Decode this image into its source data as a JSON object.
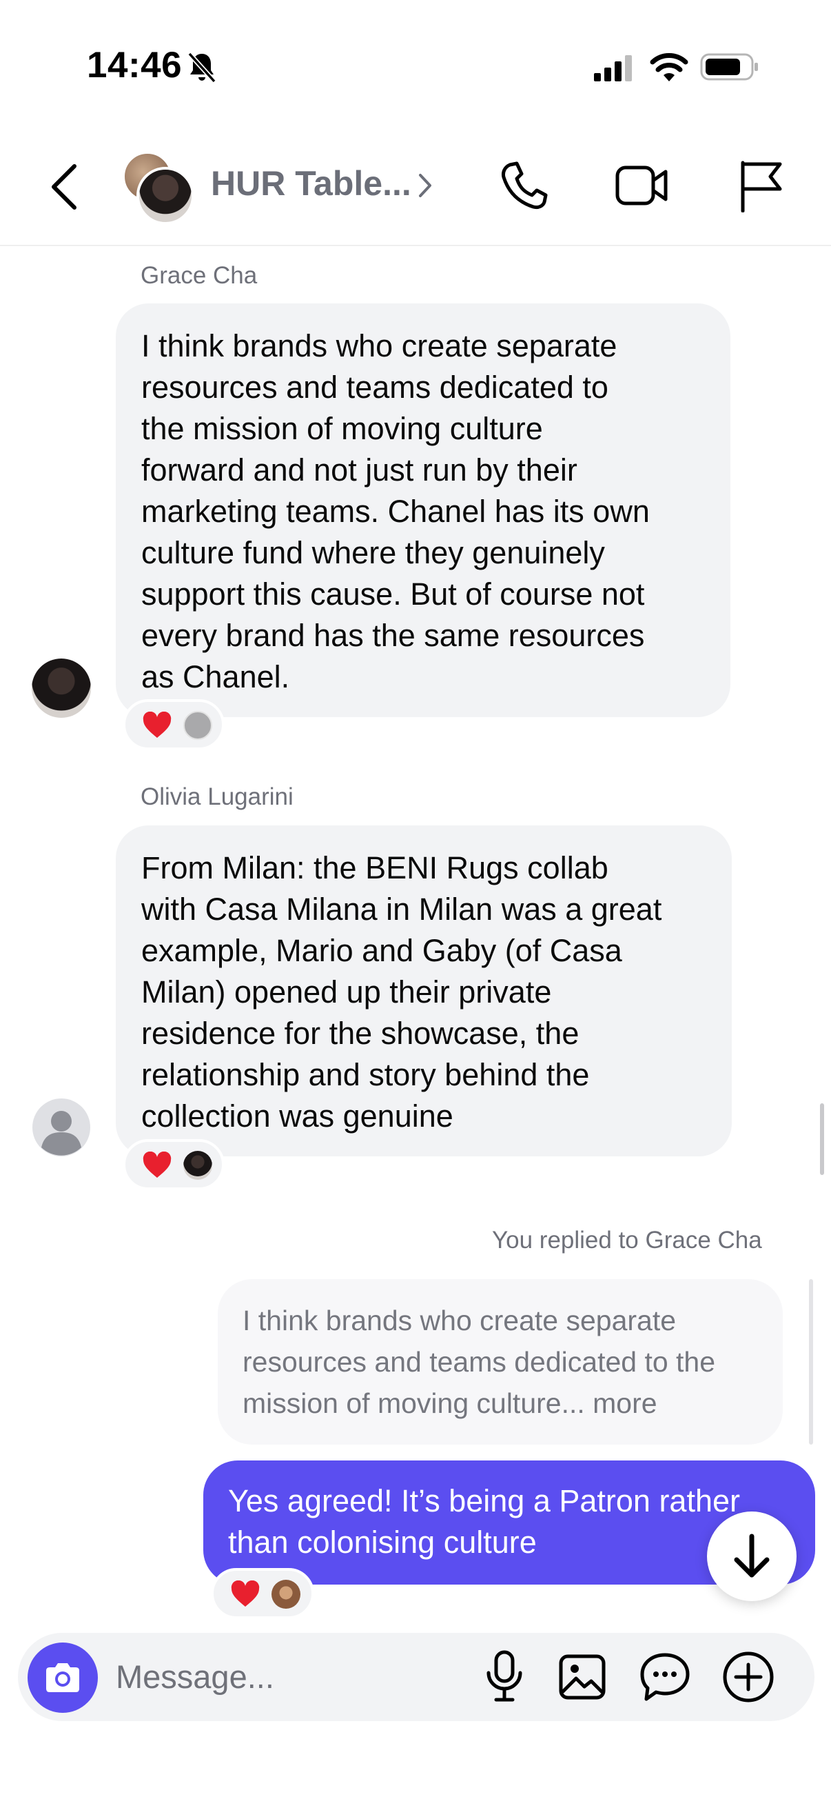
{
  "status_bar": {
    "time": "14:46"
  },
  "header": {
    "title": "HUR Table..."
  },
  "messages": [
    {
      "sender": "Grace Cha",
      "text": "I think brands who create separate resources and teams dedicated to the mission of moving culture forward and not just run by their marketing teams. Chanel has its own culture fund where they genuinely support this cause. But of course not every brand has the same resources as Chanel.",
      "lines": [
        "I think brands who create separate",
        "resources and teams dedicated to",
        "the mission of moving culture",
        "forward and not just run by their",
        "marketing teams. Chanel has its own",
        "culture fund where they genuinely",
        "support this cause. But of course not",
        "every brand has the same resources",
        "as Chanel."
      ],
      "reactions": [
        "heart"
      ]
    },
    {
      "sender": "Olivia Lugarini",
      "lines": [
        "From Milan: the BENI Rugs collab",
        "with Casa Milana in Milan was a great",
        "example, Mario and Gaby (of Casa",
        "Milan) opened up their private",
        "residence for the showcase, the",
        "relationship and story behind the",
        "collection was genuine"
      ],
      "reactions": [
        "heart"
      ]
    }
  ],
  "reply": {
    "label": "You replied to Grace Cha",
    "quote_lines": [
      "I think brands who create separate",
      "resources and teams dedicated to the",
      "mission of moving culture... more"
    ],
    "message_lines": [
      "Yes agreed! It’s being a Patron rather",
      "than colonising culture"
    ],
    "reactions": [
      "heart"
    ]
  },
  "composer": {
    "placeholder": "Message..."
  },
  "colors": {
    "accent": "#5b4ef0",
    "bubble_in": "#f2f3f5",
    "heart": "#e8202e"
  },
  "icons": [
    "back-icon",
    "call-icon",
    "video-call-icon",
    "flag-icon",
    "camera-icon",
    "microphone-icon",
    "gallery-icon",
    "sticker-icon",
    "add-icon",
    "arrow-down-icon",
    "bell-slash-icon"
  ]
}
